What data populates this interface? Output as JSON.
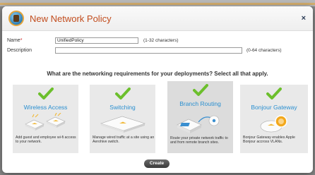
{
  "dialog": {
    "title": "New Network Policy",
    "close_label": "×"
  },
  "form": {
    "name_label": "Name",
    "name_required_mark": "*",
    "name_value": "UnifiedPolicy",
    "name_hint": "(1-32 characters)",
    "description_label": "Description",
    "description_value": "",
    "description_hint": "(0-64 characters)"
  },
  "question": "What are the networking requirements for your deployments? Select all that apply.",
  "cards": [
    {
      "title": "Wireless Access",
      "description": "Add guest and employee wi-fi access to your network.",
      "icon": "access-point-icon"
    },
    {
      "title": "Switching",
      "description": "Manage wired traffic at a site using an Aerohive switch.",
      "icon": "switch-icon"
    },
    {
      "title": "Branch Routing",
      "description": "Route your private network traffic to and from remote branch sites.",
      "icon": "router-icon"
    },
    {
      "title": "Bonjour Gateway",
      "description": "Bonjour Gateway enables Apple Bonjour accross VLANs.",
      "icon": "bonjour-gateway-icon"
    }
  ],
  "create_label": "Create",
  "colors": {
    "title": "#c24d1e",
    "card_title": "#2a8fd0",
    "check": "#6cbf2c",
    "device_accent": "#f1b93a"
  }
}
